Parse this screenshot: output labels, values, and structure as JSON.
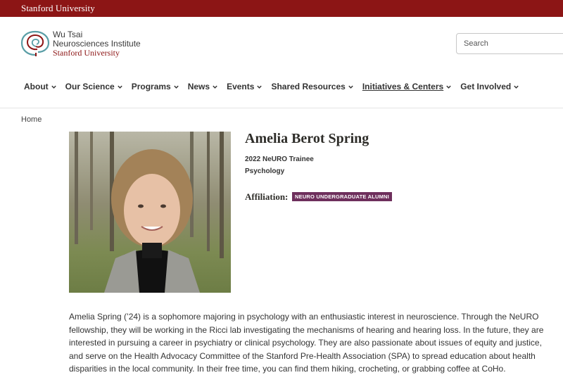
{
  "topbar": {
    "label": "Stanford University"
  },
  "logo": {
    "line1": "Wu Tsai",
    "line2": "Neurosciences Institute",
    "line3": "Stanford University"
  },
  "search": {
    "placeholder": "Search"
  },
  "nav": {
    "items": [
      {
        "label": "About"
      },
      {
        "label": "Our Science"
      },
      {
        "label": "Programs"
      },
      {
        "label": "News"
      },
      {
        "label": "Events"
      },
      {
        "label": "Shared Resources"
      },
      {
        "label": "Initiatives & Centers"
      },
      {
        "label": "Get Involved"
      }
    ]
  },
  "breadcrumb": {
    "home": "Home"
  },
  "profile": {
    "name": "Amelia Berot Spring",
    "subtitle": "2022 NeURO Trainee",
    "department": "Psychology",
    "affiliation_label": "Affiliation:",
    "affiliation_badge": "NEURO UNDERGRADUATE ALUMNI",
    "bio": "Amelia Spring (’24) is a sophomore majoring in psychology with an enthusiastic interest in neuroscience. Through the NeURO fellowship, they will be working in the Ricci lab investigating the mechanisms of hearing and hearing loss. In the future, they are interested in pursuing a career in psychiatry or clinical psychology. They are also passionate about issues of equity and justice, and serve on the Health Advocacy Committee of the Stanford Pre-Health Association (SPA) to spread education about health disparities in the local community. In their free time, you can find them hiking, crocheting, or grabbing coffee at CoHo."
  },
  "colors": {
    "stanford_red": "#8c1515",
    "badge_purple": "#6e2f5c",
    "logo_teal": "#5a9ea6"
  }
}
